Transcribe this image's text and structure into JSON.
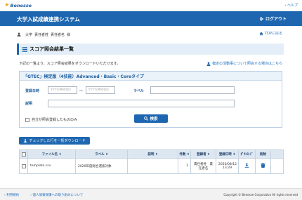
{
  "logo": {
    "mark": "✦",
    "text": "Benesse"
  },
  "help": "ヘルプ",
  "header": {
    "title": "大学入試成績連携システム",
    "logout": "ログアウト"
  },
  "user": {
    "university": "大学",
    "dept": "責任者姓",
    "name": "責任者名",
    "suffix": "様"
  },
  "top_link": "TOPに戻る",
  "section": {
    "title": "スコア照会結果一覧"
  },
  "description": "下記の一覧より、スコア照会結果をダウンロードいただけます。",
  "inquiry_link": "模定の活動事について照会する場合はこちら",
  "search": {
    "panel_title": "「GTEC」検定版（4技能）Advanced・Basic・Coreタイプ",
    "date_label": "登録日時",
    "date_from_placeholder": "YYYY/MM/DD",
    "date_to_placeholder": "YYYY/MM/DD",
    "tilde": "～",
    "label_label": "ラベル",
    "desc_label": "説明",
    "own_only": "自分が照会登録したもののみ",
    "button": "検索"
  },
  "download_button": "チェックした行を一括ダウンロード",
  "table": {
    "headers": [
      "ファイル名",
      "ラベル",
      "説明",
      "件数",
      "登録者",
      "登録日時",
      "ﾀﾞｳﾝﾛｰﾄﾞ",
      "削除"
    ],
    "rows": [
      {
        "file": "template.csv",
        "label": "2020年度総合選抜対象",
        "desc": "",
        "count": "3",
        "registrant_line1": "責任者姓　責",
        "registrant_line2": "任者名",
        "date_line1": "2020/08/12",
        "date_line2": "13:29"
      }
    ]
  },
  "footer": {
    "links": [
      "利用規約",
      "個人情報保護への取り組みについて"
    ],
    "copyright": "Copyright © Benesse Corporation All rights reserved"
  },
  "colors": {
    "primary": "#1e67b0",
    "link": "#1f6fbf",
    "accent": "#f2a51a"
  }
}
